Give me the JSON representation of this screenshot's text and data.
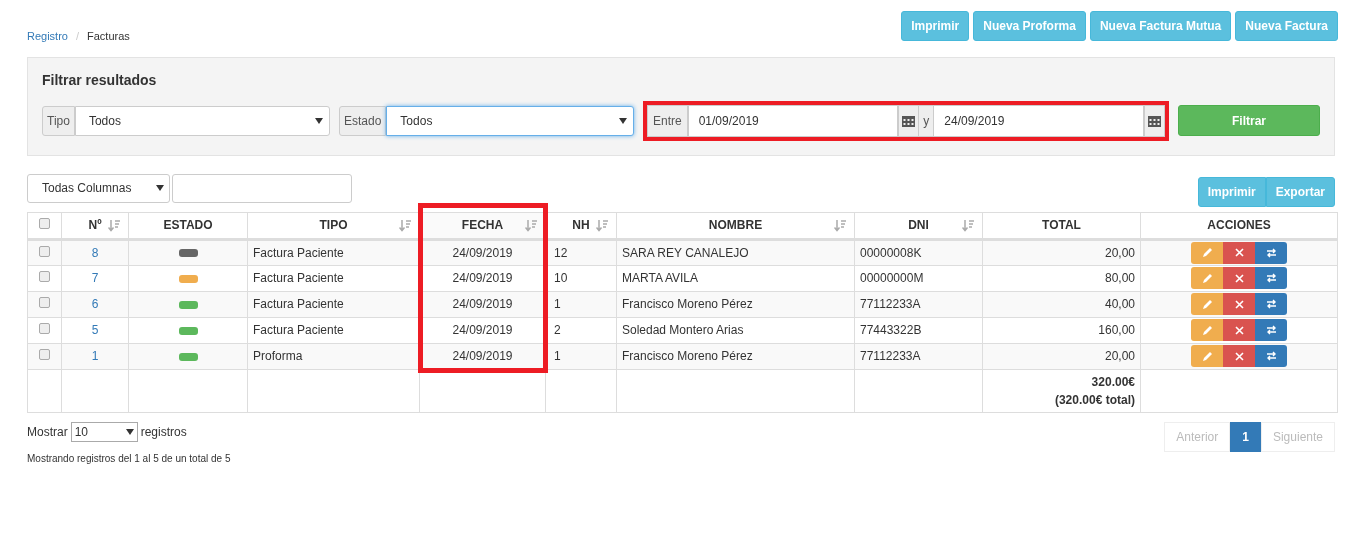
{
  "breadcrumb": {
    "separator": "/",
    "items": [
      {
        "label": "Registro",
        "link": true
      },
      {
        "label": "Facturas",
        "link": false
      }
    ]
  },
  "top_buttons": [
    "Imprimir",
    "Nueva Proforma",
    "Nueva Factura Mutua",
    "Nueva Factura"
  ],
  "filter": {
    "title": "Filtrar resultados",
    "tipo": {
      "label": "Tipo",
      "value": "Todos"
    },
    "estado": {
      "label": "Estado",
      "value": "Todos",
      "focused": true
    },
    "date_range": {
      "label": "Entre",
      "from": "01/09/2019",
      "separator": "y",
      "to": "24/09/2019",
      "highlighted": true
    },
    "button": "Filtrar"
  },
  "column_filter": {
    "value": "Todas Columnas"
  },
  "export_buttons": [
    "Imprimir",
    "Exportar"
  ],
  "table": {
    "select_all_checked": false,
    "columns": [
      {
        "label": "Nº",
        "sortable": true,
        "highlighted": false
      },
      {
        "label": "ESTADO",
        "sortable": false,
        "highlighted": false
      },
      {
        "label": "TIPO",
        "sortable": true,
        "highlighted": false
      },
      {
        "label": "FECHA",
        "sortable": true,
        "highlighted": true
      },
      {
        "label": "NH",
        "sortable": true,
        "highlighted": false
      },
      {
        "label": "NOMBRE",
        "sortable": true,
        "highlighted": false
      },
      {
        "label": "DNI",
        "sortable": true,
        "highlighted": false
      },
      {
        "label": "TOTAL",
        "sortable": false,
        "highlighted": false
      },
      {
        "label": "ACCIONES",
        "sortable": false,
        "highlighted": false
      }
    ],
    "rows": [
      {
        "checked": false,
        "numero": "8",
        "color": "#666666",
        "tipo": "Factura Paciente",
        "fecha": "24/09/2019",
        "nh": "12",
        "nombre": "SARA REY CANALEJO",
        "dni": "00000008K",
        "total": "20,00"
      },
      {
        "checked": false,
        "numero": "7",
        "color": "#f0ad4e",
        "tipo": "Factura Paciente",
        "fecha": "24/09/2019",
        "nh": "10",
        "nombre": "MARTA AVILA",
        "dni": "00000000M",
        "total": "80,00"
      },
      {
        "checked": false,
        "numero": "6",
        "color": "#5cb85c",
        "tipo": "Factura Paciente",
        "fecha": "24/09/2019",
        "nh": "1",
        "nombre": "Francisco Moreno Pérez",
        "dni": "77112233A",
        "total": "40,00"
      },
      {
        "checked": false,
        "numero": "5",
        "color": "#5cb85c",
        "tipo": "Factura Paciente",
        "fecha": "24/09/2019",
        "nh": "2",
        "nombre": "Soledad Montero Arias",
        "dni": "77443322B",
        "total": "160,00"
      },
      {
        "checked": false,
        "numero": "1",
        "color": "#5cb85c",
        "tipo": "Proforma",
        "fecha": "24/09/2019",
        "nh": "1",
        "nombre": "Francisco Moreno Pérez",
        "dni": "77112233A",
        "total": "20,00"
      }
    ],
    "footer_total": [
      "320.00€",
      "(320.00€ total)"
    ]
  },
  "length": {
    "before": "Mostrar",
    "value": "10",
    "after": "registros"
  },
  "info": "Mostrando registros del 1 al 5 de un total de 5",
  "pagination": [
    {
      "label": "Anterior",
      "disabled": true,
      "selected": false
    },
    {
      "label": "1",
      "disabled": false,
      "selected": true
    },
    {
      "label": "Siguiente",
      "disabled": true,
      "selected": false
    }
  ]
}
